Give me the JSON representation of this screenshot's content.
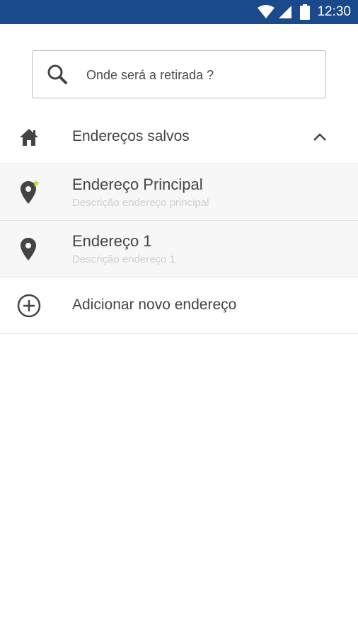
{
  "status_bar": {
    "time": "12:30",
    "icons": [
      "wifi-icon",
      "signal-icon",
      "battery-icon"
    ],
    "color": "#1a4a8c"
  },
  "search": {
    "placeholder": "Onde será a retirada ?"
  },
  "saved_section": {
    "title": "Endereços salvos",
    "expanded": true
  },
  "addresses": [
    {
      "name": "Endereço Principal",
      "description": "Descrição endereço principal",
      "is_main": true
    },
    {
      "name": "Endereço 1",
      "description": "Descrição endereço 1",
      "is_main": false
    }
  ],
  "add_address": {
    "label": "Adicionar novo endereço"
  },
  "colors": {
    "accent_star": "#c6d83b",
    "icon": "#444444"
  }
}
